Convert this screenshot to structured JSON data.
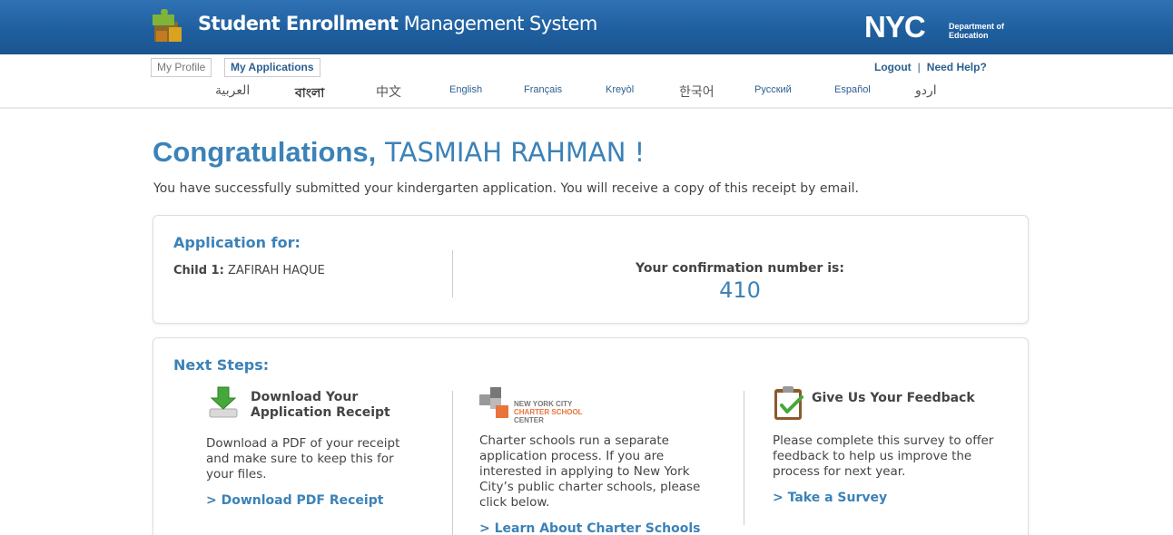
{
  "header": {
    "app_title_bold": "Student Enrollment",
    "app_title_light": "Management System",
    "org_logo": "NYC",
    "org_department": "Department of",
    "org_department_2": "Education"
  },
  "nav": {
    "tabs": [
      {
        "label": "My Profile"
      },
      {
        "label": "My Applications"
      }
    ],
    "logout": "Logout",
    "separator": "|",
    "help": "Need Help?"
  },
  "languages": [
    "العربية",
    "বাংলা",
    "中文",
    "English",
    "Français",
    "Kreyòl",
    "한국어",
    "Русский",
    "Español",
    "اردو"
  ],
  "page": {
    "congrats_word": "Congratulations,",
    "applicant_name": "TASMIAH RAHMAN !",
    "subtitle": "You have successfully submitted your kindergarten application. You will receive a copy of this receipt by email."
  },
  "application": {
    "heading": "Application for:",
    "child_label": "Child 1:",
    "child_name": "ZAFIRAH HAQUE",
    "confirm_label": "Your confirmation number is:",
    "confirm_number": "410"
  },
  "next_steps": {
    "heading": "Next Steps:",
    "download": {
      "title": "Download Your Application Receipt",
      "text": "Download a PDF of your receipt and make sure to keep this for your files.",
      "link": "> Download PDF Receipt",
      "icon": "download-arrow-icon"
    },
    "charter": {
      "logo_line1": "NEW YORK CITY",
      "logo_line2": "CHARTER SCHOOL",
      "logo_line3": "CENTER",
      "text": "Charter schools run a separate application process. If you are interested in applying to New York City’s public charter schools, please click below.",
      "link": "> Learn About Charter Schools"
    },
    "feedback": {
      "title": "Give Us Your Feedback",
      "text": "Please complete this survey to offer feedback to help us improve the process for next year.",
      "link": "> Take a Survey",
      "icon": "clipboard-check-icon"
    }
  },
  "colors": {
    "header_blue": "#1f5f9f",
    "accent_blue": "#3b82b8",
    "nav_blue": "#2b5f8f",
    "charter_orange": "#e8743b"
  }
}
